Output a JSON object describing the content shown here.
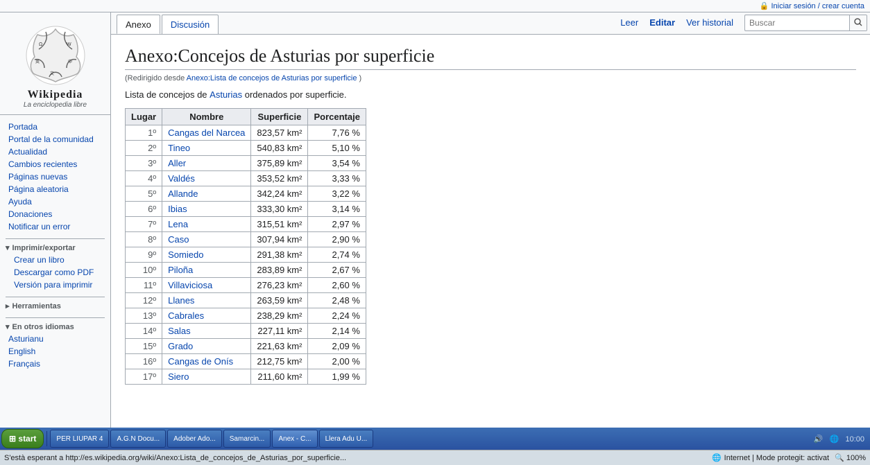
{
  "topbar": {
    "login_text": "Iniciar sesión / crear cuenta",
    "icon": "🔒"
  },
  "logo": {
    "title": "Wikipedia",
    "subtitle": "La enciclopedia libre"
  },
  "sidebar": {
    "nav_items": [
      {
        "id": "portada",
        "label": "Portada"
      },
      {
        "id": "portal",
        "label": "Portal de la comunidad"
      },
      {
        "id": "actualidad",
        "label": "Actualidad"
      },
      {
        "id": "cambios",
        "label": "Cambios recientes"
      },
      {
        "id": "paginas-nuevas",
        "label": "Páginas nuevas"
      },
      {
        "id": "pagina-aleatoria",
        "label": "Página aleatoria"
      },
      {
        "id": "ayuda",
        "label": "Ayuda"
      },
      {
        "id": "donaciones",
        "label": "Donaciones"
      },
      {
        "id": "notificar",
        "label": "Notificar un error"
      }
    ],
    "imprimir_title": "Imprimir/exportar",
    "imprimir_items": [
      {
        "id": "crear-libro",
        "label": "Crear un libro"
      },
      {
        "id": "descargar-pdf",
        "label": "Descargar como PDF"
      },
      {
        "id": "version-imprimir",
        "label": "Versión para imprimir"
      }
    ],
    "herramientas_title": "Herramientas",
    "otros_idiomas_title": "En otros idiomas",
    "idiomas": [
      {
        "id": "asturianu",
        "label": "Asturianu"
      },
      {
        "id": "english",
        "label": "English"
      },
      {
        "id": "francais",
        "label": "Français"
      }
    ]
  },
  "tabs": {
    "anexo": "Anexo",
    "discusion": "Discusión",
    "leer": "Leer",
    "editar": "Editar",
    "historial": "Ver historial",
    "search_placeholder": "Buscar"
  },
  "page": {
    "title": "Anexo:Concejos de Asturias por superficie",
    "redirect_text": "(Redirigido desde",
    "redirect_link": "Anexo:Lista de concejos de Asturias por superficie",
    "redirect_close": ")",
    "intro_prefix": "Lista de concejos de",
    "intro_link": "Asturias",
    "intro_suffix": "ordenados por superficie."
  },
  "table": {
    "headers": [
      "Lugar",
      "Nombre",
      "Superficie",
      "Porcentaje"
    ],
    "rows": [
      {
        "lugar": "1º",
        "nombre": "Cangas del Narcea",
        "superficie": "823,57 km²",
        "porcentaje": "7,76 %"
      },
      {
        "lugar": "2º",
        "nombre": "Tineo",
        "superficie": "540,83 km²",
        "porcentaje": "5,10 %"
      },
      {
        "lugar": "3º",
        "nombre": "Aller",
        "superficie": "375,89 km²",
        "porcentaje": "3,54 %"
      },
      {
        "lugar": "4º",
        "nombre": "Valdés",
        "superficie": "353,52 km²",
        "porcentaje": "3,33 %"
      },
      {
        "lugar": "5º",
        "nombre": "Allande",
        "superficie": "342,24 km²",
        "porcentaje": "3,22 %"
      },
      {
        "lugar": "6º",
        "nombre": "Ibias",
        "superficie": "333,30 km²",
        "porcentaje": "3,14 %"
      },
      {
        "lugar": "7º",
        "nombre": "Lena",
        "superficie": "315,51 km²",
        "porcentaje": "2,97 %"
      },
      {
        "lugar": "8º",
        "nombre": "Caso",
        "superficie": "307,94 km²",
        "porcentaje": "2,90 %"
      },
      {
        "lugar": "9º",
        "nombre": "Somiedo",
        "superficie": "291,38 km²",
        "porcentaje": "2,74 %"
      },
      {
        "lugar": "10º",
        "nombre": "Piloña",
        "superficie": "283,89 km²",
        "porcentaje": "2,67 %"
      },
      {
        "lugar": "11º",
        "nombre": "Villaviciosa",
        "superficie": "276,23 km²",
        "porcentaje": "2,60 %"
      },
      {
        "lugar": "12º",
        "nombre": "Llanes",
        "superficie": "263,59 km²",
        "porcentaje": "2,48 %"
      },
      {
        "lugar": "13º",
        "nombre": "Cabrales",
        "superficie": "238,29 km²",
        "porcentaje": "2,24 %"
      },
      {
        "lugar": "14º",
        "nombre": "Salas",
        "superficie": "227,11 km²",
        "porcentaje": "2,14 %"
      },
      {
        "lugar": "15º",
        "nombre": "Grado",
        "superficie": "221,63 km²",
        "porcentaje": "2,09 %"
      },
      {
        "lugar": "16º",
        "nombre": "Cangas de Onís",
        "superficie": "212,75 km²",
        "porcentaje": "2,00 %"
      },
      {
        "lugar": "17º",
        "nombre": "Siero",
        "superficie": "211,60 km²",
        "porcentaje": "1,99 %"
      }
    ]
  },
  "statusbar": {
    "url": "S'està esperant a http://es.wikipedia.org/wiki/Anexo:Lista_de_concejos_de_Asturias_por_superficie...",
    "internet": "Internet | Mode protegit: activat",
    "zoom": "100%"
  },
  "taskbar": {
    "start": "start",
    "buttons": [
      "PER LIUPAR 4",
      "A.G.N Docu...",
      "Adober Ado...",
      "Samarcin...",
      "Anex - C...",
      "Llera Adu U..."
    ]
  }
}
